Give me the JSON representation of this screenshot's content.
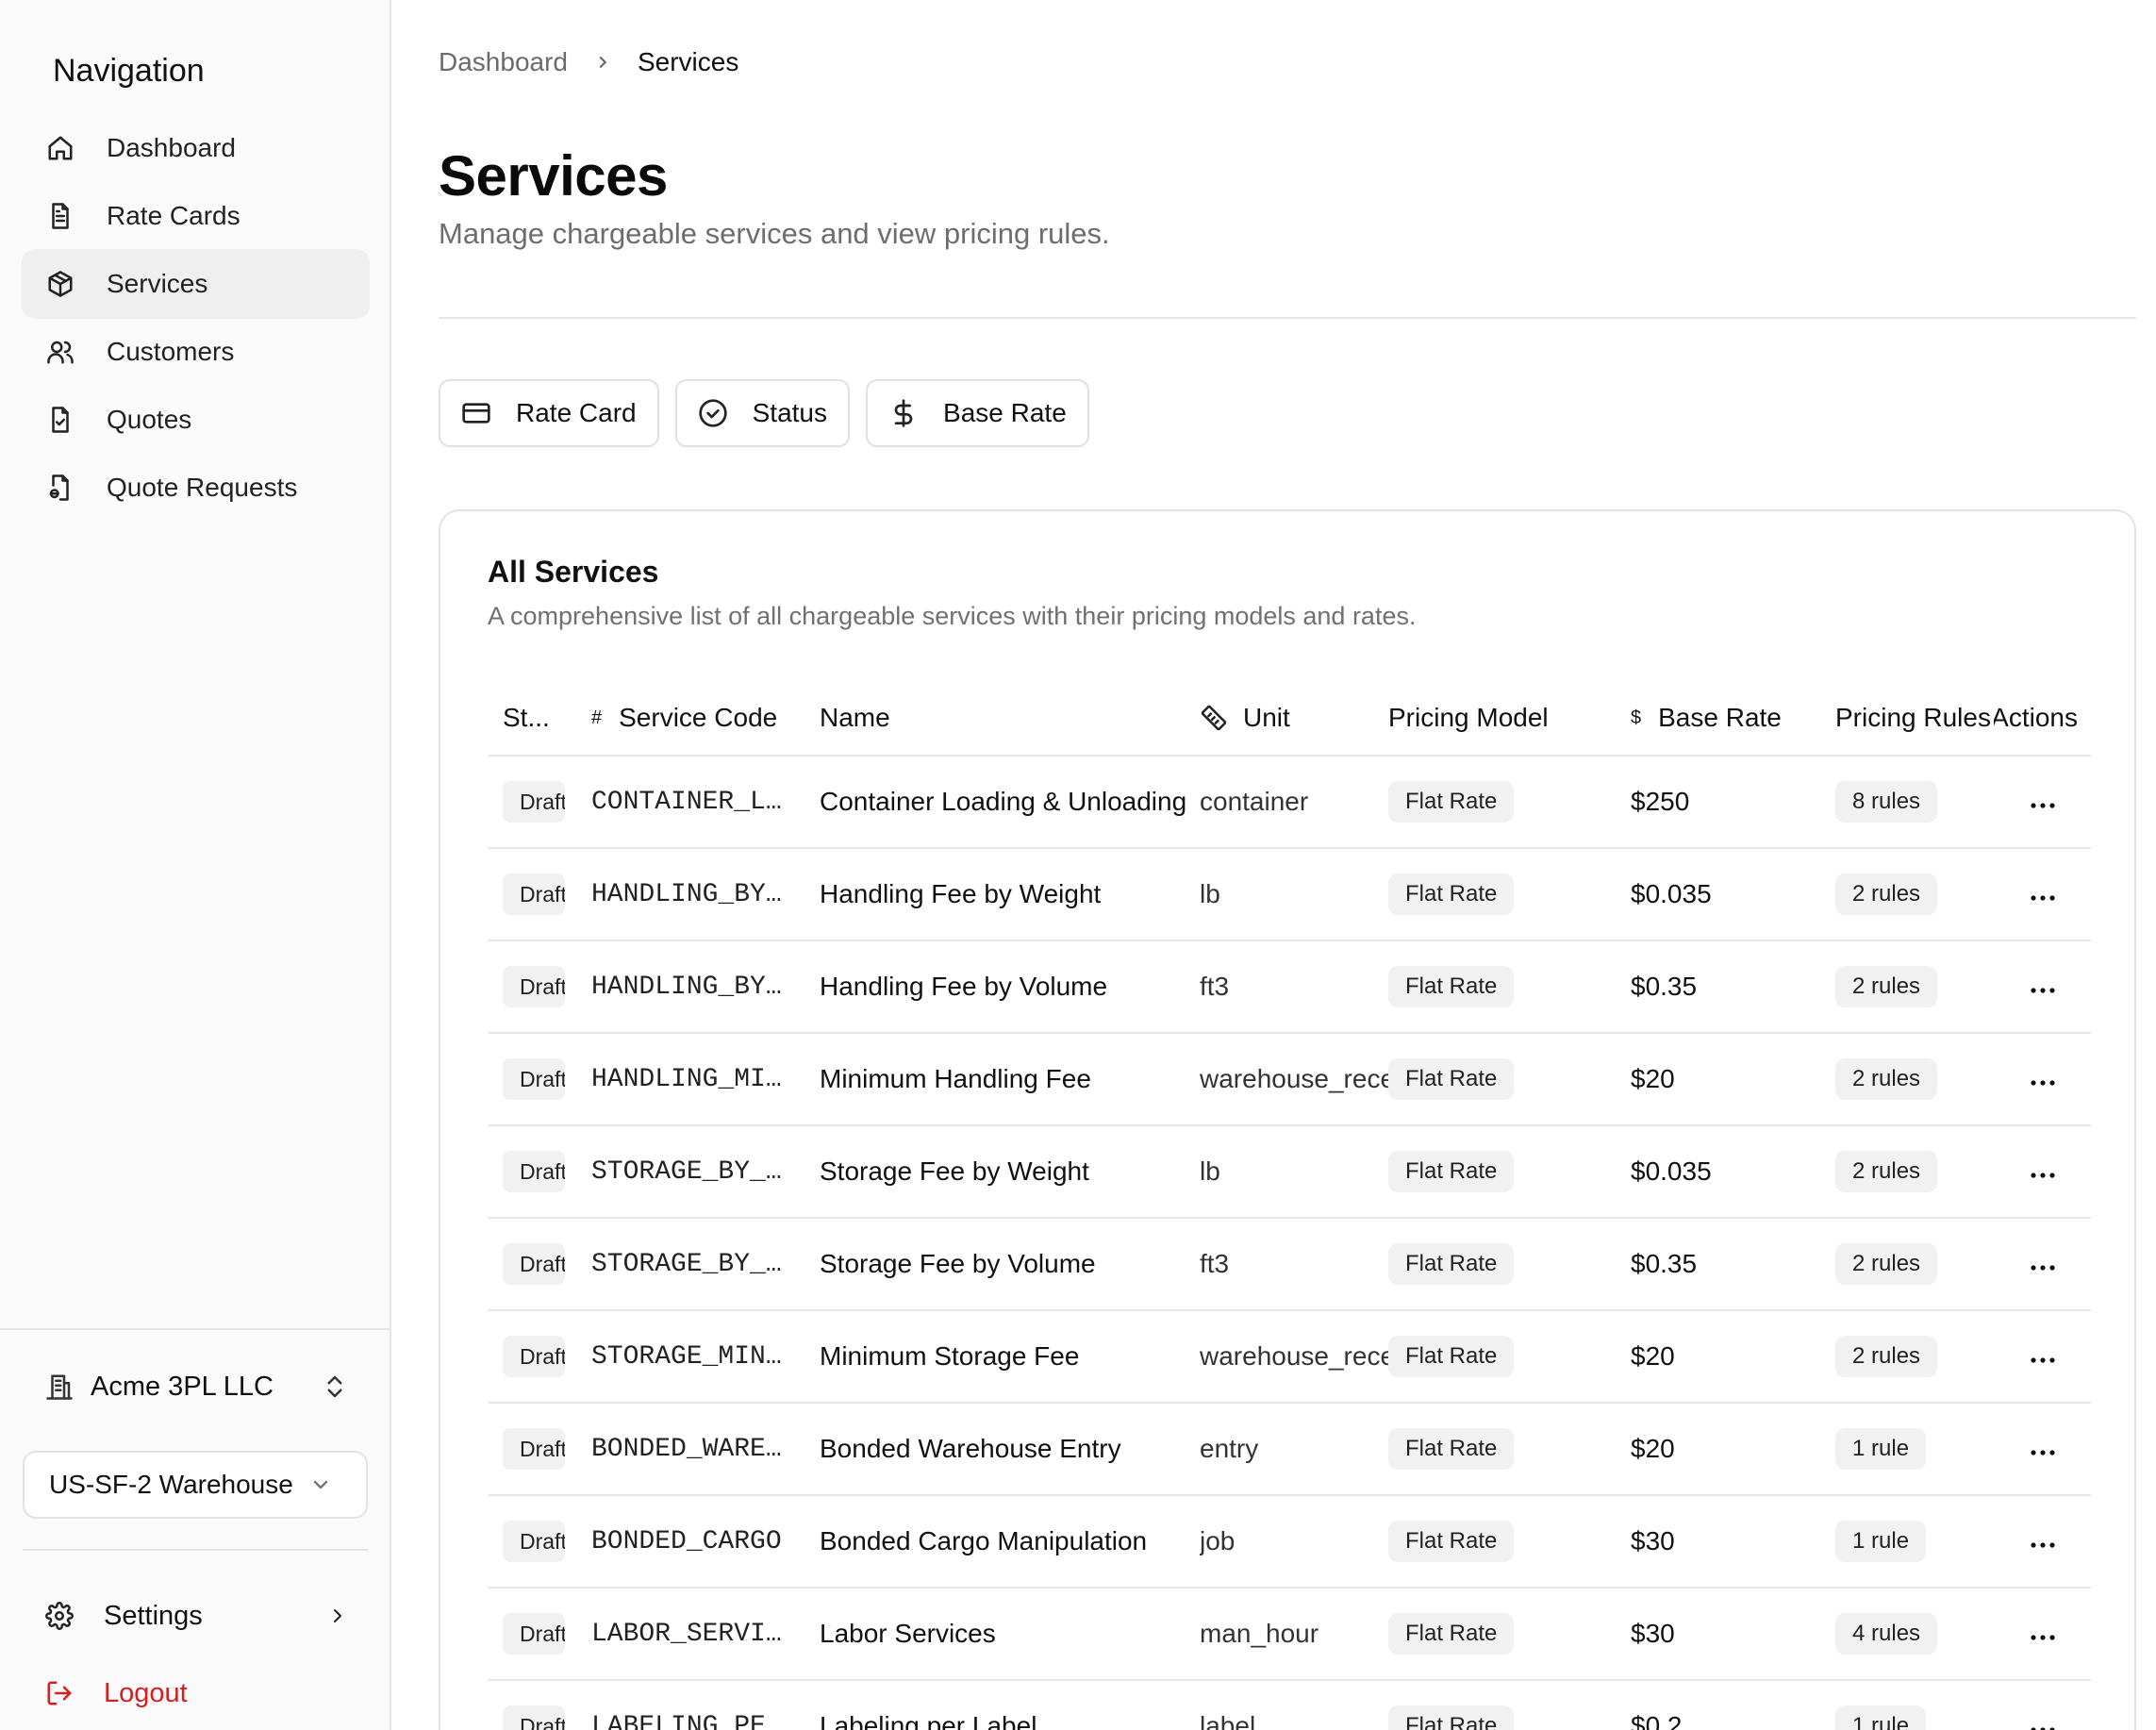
{
  "sidebar": {
    "title": "Navigation",
    "items": [
      {
        "label": "Dashboard",
        "icon": "home-icon",
        "active": false
      },
      {
        "label": "Rate Cards",
        "icon": "file-text-icon",
        "active": false
      },
      {
        "label": "Services",
        "icon": "package-icon",
        "active": true
      },
      {
        "label": "Customers",
        "icon": "users-icon",
        "active": false
      },
      {
        "label": "Quotes",
        "icon": "file-check-icon",
        "active": false
      },
      {
        "label": "Quote Requests",
        "icon": "file-request-icon",
        "active": false
      }
    ],
    "organization": "Acme 3PL LLC",
    "warehouse": "US-SF-2 Warehouse",
    "settings_label": "Settings",
    "logout_label": "Logout"
  },
  "breadcrumb": {
    "parent": "Dashboard",
    "current": "Services"
  },
  "page": {
    "title": "Services",
    "subtitle": "Manage chargeable services and view pricing rules."
  },
  "filters": {
    "rate_card": "Rate Card",
    "status": "Status",
    "base_rate": "Base Rate"
  },
  "card": {
    "title": "All Services",
    "subtitle": "A comprehensive list of all chargeable services with their pricing models and rates."
  },
  "table": {
    "headers": {
      "status": "St...",
      "code": "Service Code",
      "code_prefix": "#",
      "name": "Name",
      "unit": "Unit",
      "model": "Pricing Model",
      "rate": "Base Rate",
      "rate_prefix": "$",
      "rules": "Pricing Rules",
      "actions": "Actions"
    },
    "rows": [
      {
        "status": "Draft",
        "code": "CONTAINER_LOADING",
        "name": "Container Loading & Unloading",
        "unit": "container",
        "model": "Flat Rate",
        "rate": "$250",
        "rules": "8 rules"
      },
      {
        "status": "Draft",
        "code": "HANDLING_BY_WEIGHT",
        "name": "Handling Fee by Weight",
        "unit": "lb",
        "model": "Flat Rate",
        "rate": "$0.035",
        "rules": "2 rules"
      },
      {
        "status": "Draft",
        "code": "HANDLING_BY_VOLUME",
        "name": "Handling Fee by Volume",
        "unit": "ft3",
        "model": "Flat Rate",
        "rate": "$0.35",
        "rules": "2 rules"
      },
      {
        "status": "Draft",
        "code": "HANDLING_MINIMUM",
        "name": "Minimum Handling Fee",
        "unit": "warehouse_receipt",
        "model": "Flat Rate",
        "rate": "$20",
        "rules": "2 rules"
      },
      {
        "status": "Draft",
        "code": "STORAGE_BY_WEIGHT",
        "name": "Storage Fee by Weight",
        "unit": "lb",
        "model": "Flat Rate",
        "rate": "$0.035",
        "rules": "2 rules"
      },
      {
        "status": "Draft",
        "code": "STORAGE_BY_VOLUME",
        "name": "Storage Fee by Volume",
        "unit": "ft3",
        "model": "Flat Rate",
        "rate": "$0.35",
        "rules": "2 rules"
      },
      {
        "status": "Draft",
        "code": "STORAGE_MINIMUM",
        "name": "Minimum Storage Fee",
        "unit": "warehouse_receipt",
        "model": "Flat Rate",
        "rate": "$20",
        "rules": "2 rules"
      },
      {
        "status": "Draft",
        "code": "BONDED_WAREHOUSE",
        "name": "Bonded Warehouse Entry",
        "unit": "entry",
        "model": "Flat Rate",
        "rate": "$20",
        "rules": "1 rule"
      },
      {
        "status": "Draft",
        "code": "BONDED_CARGO",
        "name": "Bonded Cargo Manipulation",
        "unit": "job",
        "model": "Flat Rate",
        "rate": "$30",
        "rules": "1 rule"
      },
      {
        "status": "Draft",
        "code": "LABOR_SERVICES",
        "name": "Labor Services",
        "unit": "man_hour",
        "model": "Flat Rate",
        "rate": "$30",
        "rules": "4 rules"
      },
      {
        "status": "Draft",
        "code": "LABELING_PER_LABEL",
        "name": "Labeling per Label",
        "unit": "label",
        "model": "Flat Rate",
        "rate": "$0.2",
        "rules": "1 rule"
      }
    ]
  }
}
